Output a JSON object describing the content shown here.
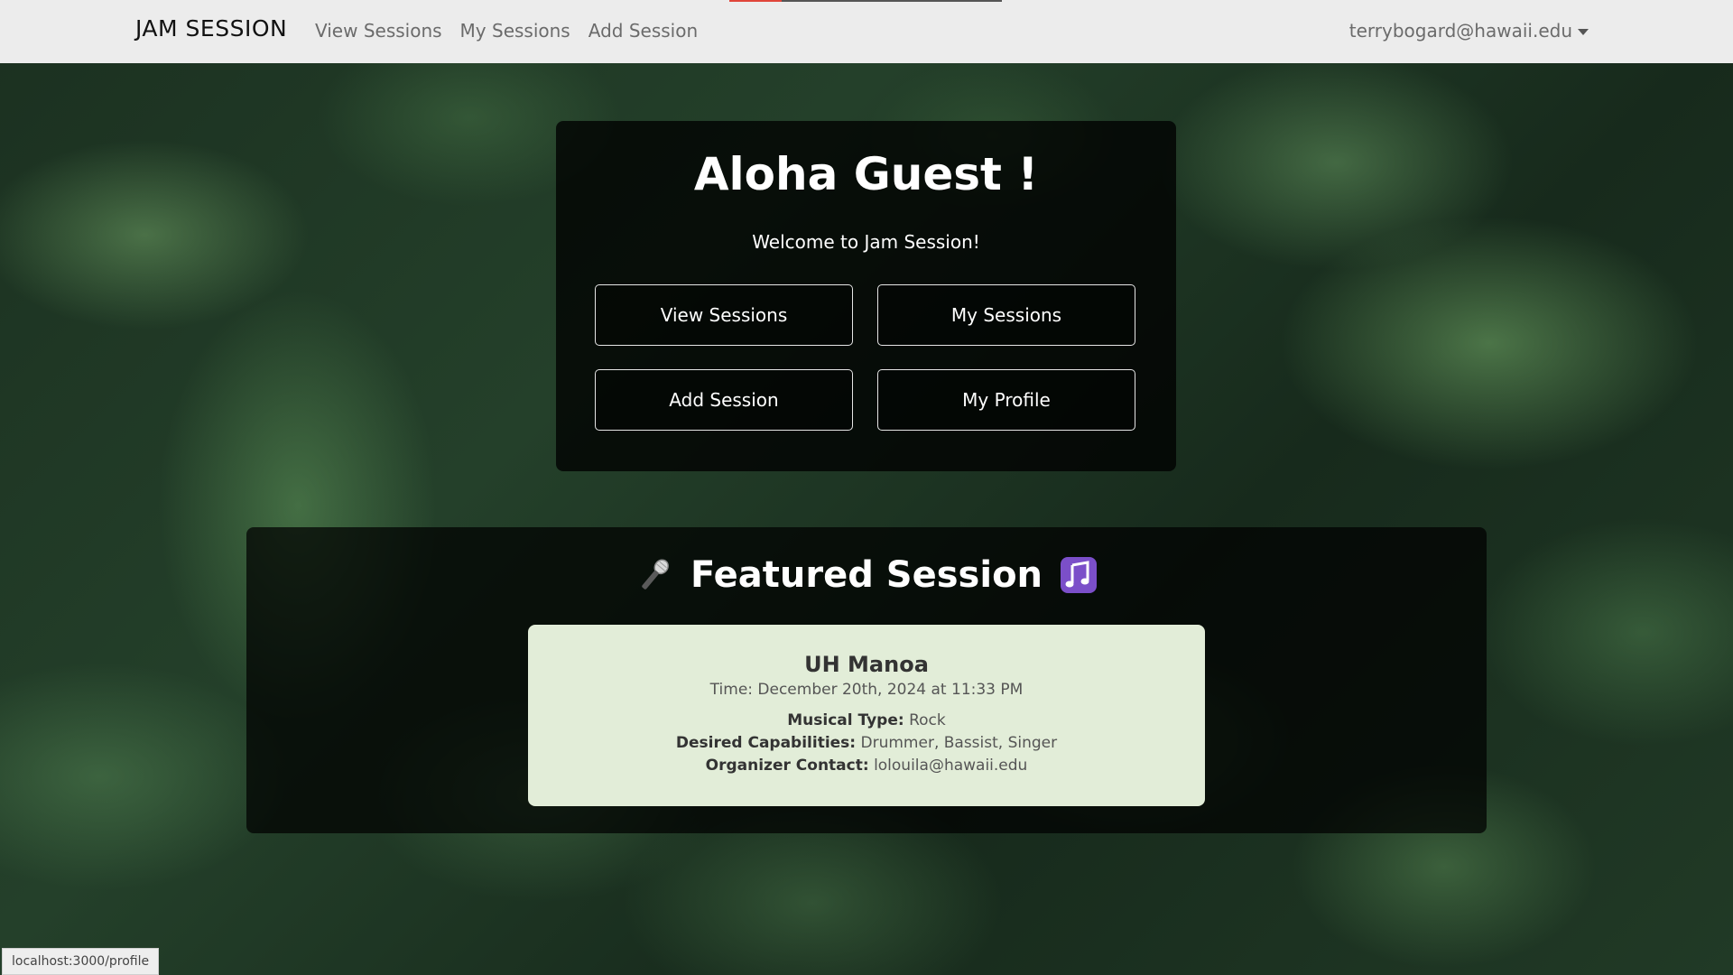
{
  "navbar": {
    "brand": "JAM SESSION",
    "links": [
      "View Sessions",
      "My Sessions",
      "Add Session"
    ],
    "user_email": "terrybogard@hawaii.edu"
  },
  "welcome": {
    "title": "Aloha Guest !",
    "subtitle": "Welcome to Jam Session!",
    "buttons": [
      "View Sessions",
      "My Sessions",
      "Add Session",
      "My Profile"
    ]
  },
  "featured": {
    "title": "Featured Session",
    "icons": [
      "microphone-icon",
      "music-notes-icon"
    ],
    "session": {
      "name": "UH Manoa",
      "time": "Time: December 20th, 2024 at 11:33 PM",
      "musical_type_label": "Musical Type:",
      "musical_type": "Rock",
      "capabilities_label": "Desired Capabilities:",
      "capabilities": "Drummer, Bassist, Singer",
      "contact_label": "Organizer Contact:",
      "contact": "lolouila@hawaii.edu"
    }
  },
  "status_bar": {
    "url": "localhost:3000/profile"
  },
  "colors": {
    "navbar_bg": "#ececec",
    "card_bg": "#e2edd8",
    "music_icon": "#7b4fc9"
  }
}
